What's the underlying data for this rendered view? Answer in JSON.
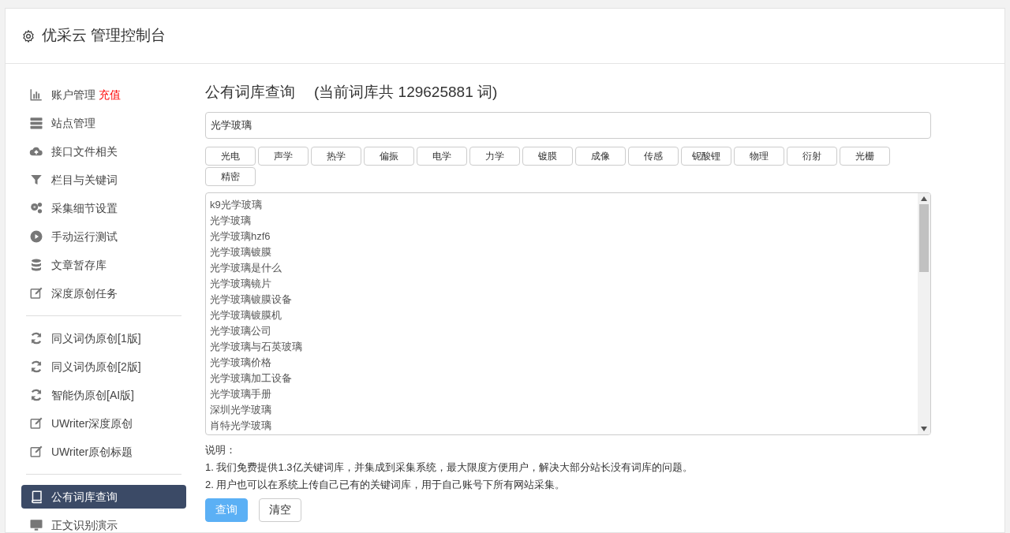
{
  "header": {
    "title": "优采云 管理控制台"
  },
  "sidebar": {
    "groups": [
      [
        {
          "label": "账户管理",
          "badge": "充值",
          "kind": "chart",
          "selected": false
        },
        {
          "label": "站点管理",
          "kind": "server",
          "selected": false
        },
        {
          "label": "接口文件相关",
          "kind": "cloud",
          "selected": false
        },
        {
          "label": "栏目与关键词",
          "kind": "filter",
          "selected": false
        },
        {
          "label": "采集细节设置",
          "kind": "gears",
          "selected": false
        },
        {
          "label": "手动运行测试",
          "kind": "play",
          "selected": false
        },
        {
          "label": "文章暂存库",
          "kind": "database",
          "selected": false
        },
        {
          "label": "深度原创任务",
          "kind": "edit",
          "selected": false
        }
      ],
      [
        {
          "label": "同义词伪原创[1版]",
          "kind": "refresh",
          "selected": false
        },
        {
          "label": "同义词伪原创[2版]",
          "kind": "refresh",
          "selected": false
        },
        {
          "label": "智能伪原创[AI版]",
          "kind": "refresh",
          "selected": false
        },
        {
          "label": "UWriter深度原创",
          "kind": "edit",
          "selected": false
        },
        {
          "label": "UWriter原创标题",
          "kind": "edit",
          "selected": false
        }
      ],
      [
        {
          "label": "公有词库查询",
          "kind": "book",
          "selected": true
        },
        {
          "label": "正文识别演示",
          "kind": "monitor",
          "selected": false
        }
      ]
    ]
  },
  "main": {
    "title": "公有词库查询",
    "subtitle": "(当前词库共 129625881 词)",
    "search": {
      "value": "光学玻璃"
    },
    "tags": [
      "光电",
      "声学",
      "热学",
      "偏振",
      "电学",
      "力学",
      "镀膜",
      "成像",
      "传感",
      "铌酸锂",
      "物理",
      "衍射",
      "光栅",
      "精密"
    ],
    "results": [
      "k9光学玻璃",
      "光学玻璃",
      "光学玻璃hzf6",
      "光学玻璃镀膜",
      "光学玻璃是什么",
      "光学玻璃镜片",
      "光学玻璃镀膜设备",
      "光学玻璃镀膜机",
      "光学玻璃公司",
      "光学玻璃与石英玻璃",
      "光学玻璃价格",
      "光学玻璃加工设备",
      "光学玻璃手册",
      "深圳光学玻璃",
      "肖特光学玻璃"
    ],
    "notes_title": "说明：",
    "notes": [
      "1. 我们免费提供1.3亿关键词库，并集成到采集系统，最大限度方便用户，解决大部分站长没有词库的问题。",
      "2. 用户也可以在系统上传自己已有的关键词库，用于自己账号下所有网站采集。"
    ],
    "buttons": [
      {
        "label": "查询",
        "kind": "primary"
      },
      {
        "label": "清空",
        "kind": "default"
      }
    ]
  }
}
